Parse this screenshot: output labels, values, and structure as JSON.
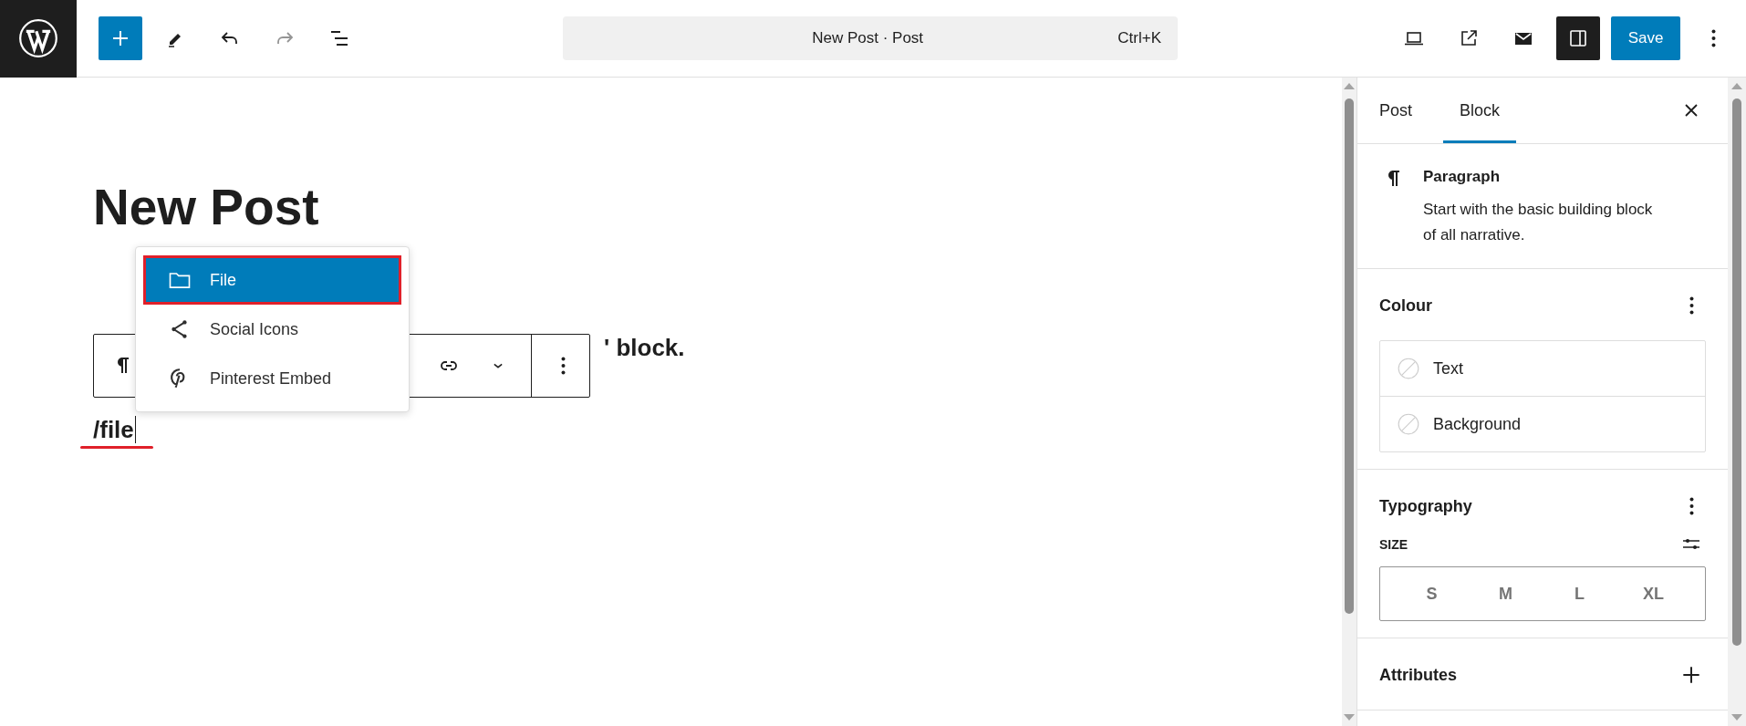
{
  "top_bar": {
    "history": {
      "undo_disabled": false,
      "redo_disabled": true
    },
    "command_bar": {
      "title": "New Post · Post",
      "shortcut": "Ctrl+K"
    },
    "sidebar_toggle": {
      "on": true
    },
    "save_button": "Save"
  },
  "editor": {
    "title": "New Post",
    "paragraph_tail": "' block.",
    "typed_text": "/file"
  },
  "inserter_menu": {
    "items": [
      {
        "label": "File",
        "kind": "folder",
        "selected": true
      },
      {
        "label": "Social Icons",
        "kind": "share",
        "selected": false
      },
      {
        "label": "Pinterest Embed",
        "kind": "pinterest",
        "selected": false
      }
    ]
  },
  "sidebar": {
    "tabs": [
      {
        "label": "Post",
        "selected": false
      },
      {
        "label": "Block",
        "selected": true
      }
    ],
    "block_card": {
      "title": "Paragraph",
      "description": "Start with the basic building block of all narrative."
    },
    "panels": [
      {
        "kind": "color",
        "title": "Colour",
        "items": [
          "Text",
          "Background"
        ]
      },
      {
        "kind": "typography",
        "title": "Typography",
        "size_label": "SIZE",
        "sizes": [
          {
            "label": "S",
            "selected": false
          },
          {
            "label": "M",
            "selected": false
          },
          {
            "label": "L",
            "selected": false
          },
          {
            "label": "XL",
            "selected": false
          }
        ]
      },
      {
        "kind": "collapsed",
        "title": "Attributes"
      }
    ]
  }
}
